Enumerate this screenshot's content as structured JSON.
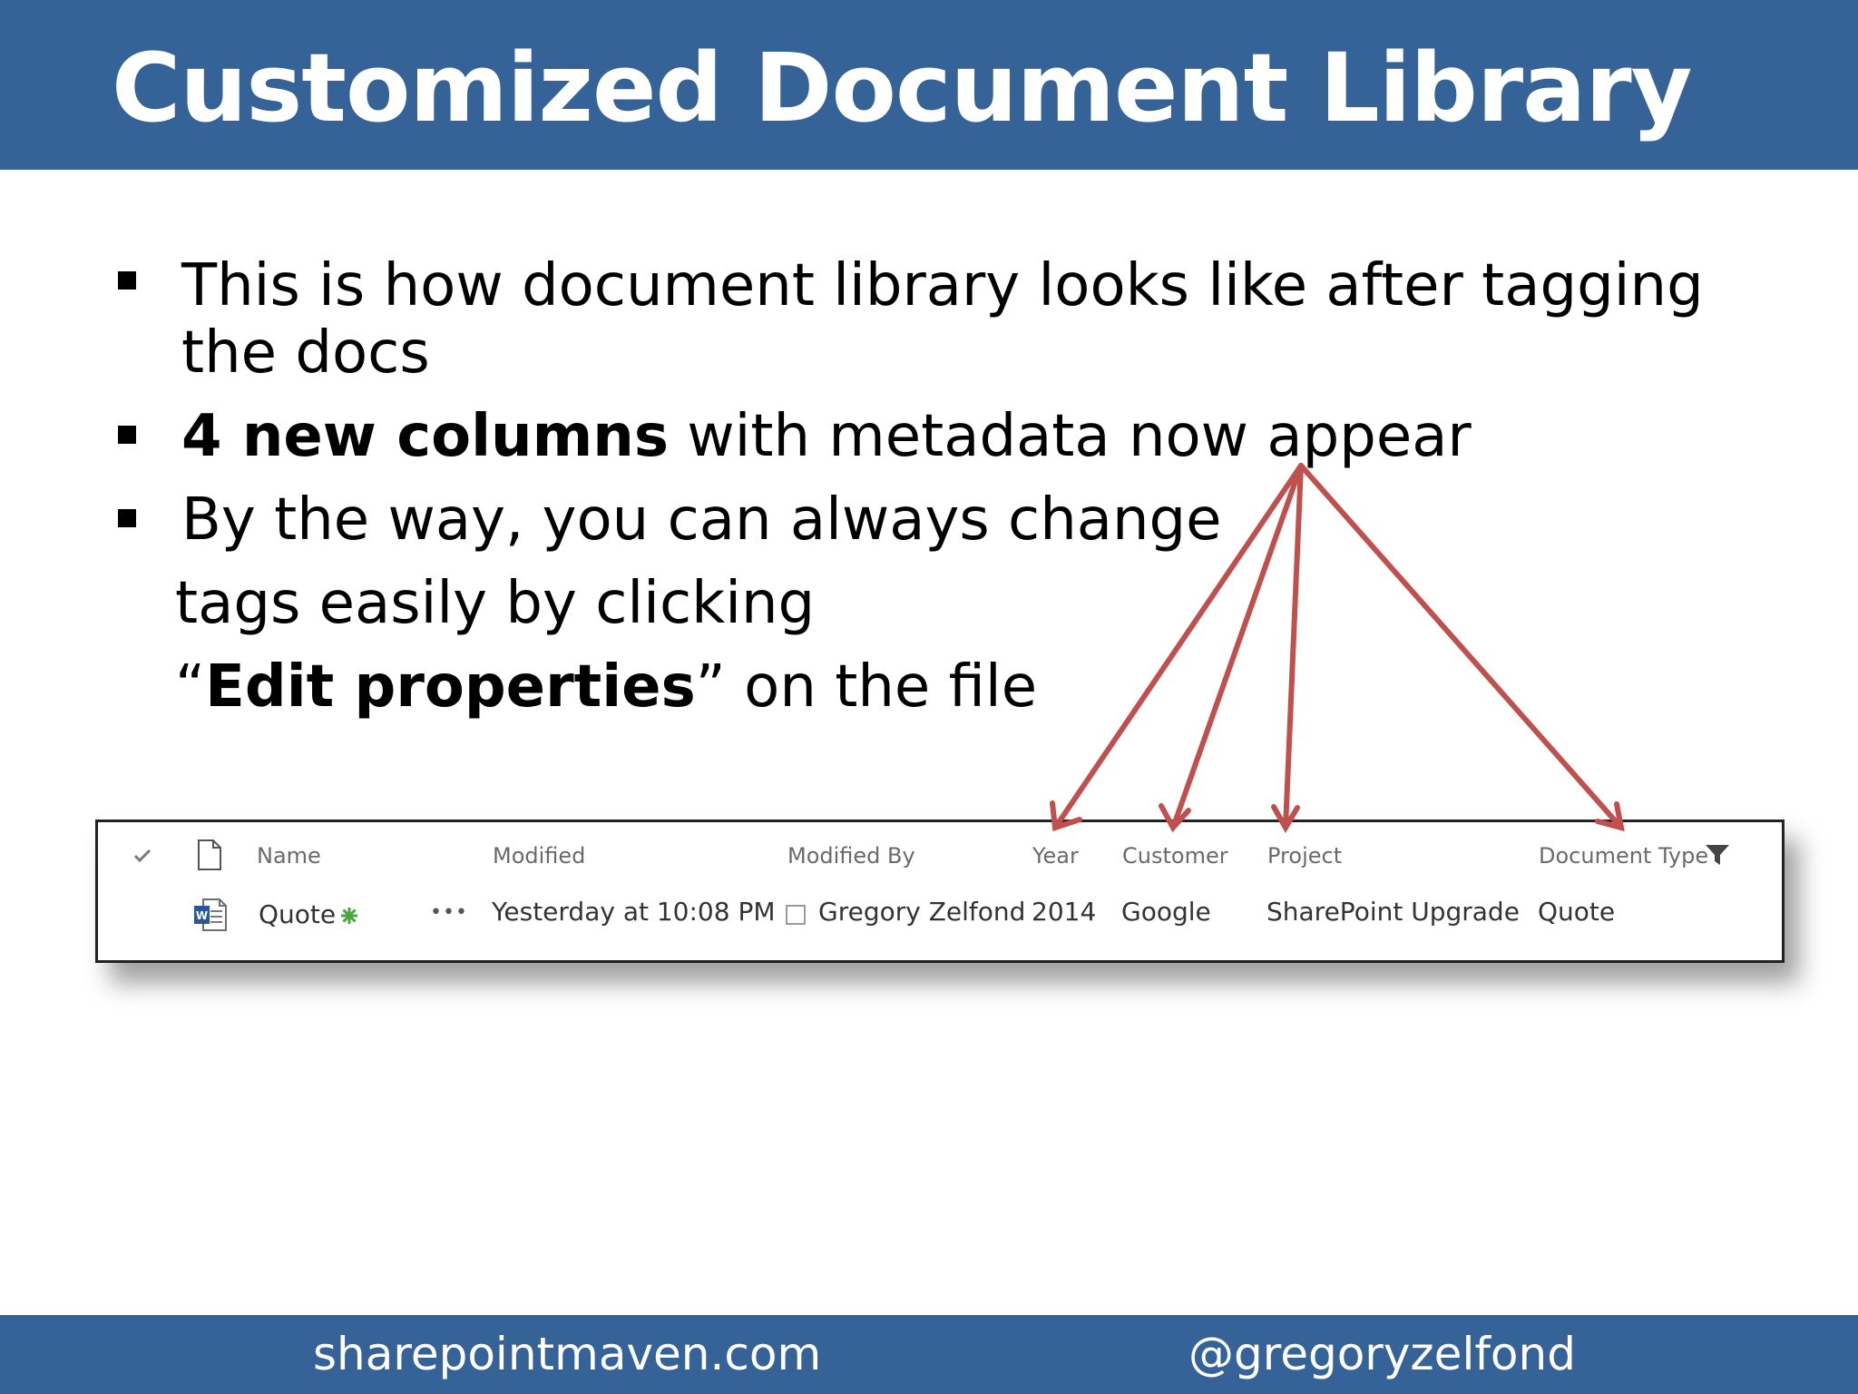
{
  "slide": {
    "title": "Customized Document Library",
    "bullets": [
      {
        "lines": [
          "This is how document library looks like after tagging",
          "the docs"
        ]
      },
      {
        "bold": "4 new columns",
        "rest": " with metadata now appear"
      },
      {
        "lines": [
          "By the way, you can always change",
          "tags easily by clicking"
        ],
        "quote_open": "“",
        "bold": "Edit properties",
        "quote_close": "”",
        "rest": " on the file"
      }
    ]
  },
  "library": {
    "columns": {
      "check_icon": "checkmark-icon",
      "type_icon": "document-icon",
      "name": "Name",
      "modified": "Modified",
      "modified_by": "Modified By",
      "year": "Year",
      "customer": "Customer",
      "project": "Project",
      "document_type": "Document Type",
      "filter_icon": "filter-icon"
    },
    "rows": [
      {
        "type_icon": "word-document-icon",
        "name": "Quote",
        "new_icon": "new-item-icon",
        "more": "•••",
        "modified": "Yesterday at 10:08 PM",
        "presence_icon": "presence-checkbox-icon",
        "modified_by": "Gregory Zelfond",
        "year": "2014",
        "customer": "Google",
        "project": "SharePoint Upgrade",
        "document_type": "Quote"
      }
    ]
  },
  "annotation": {
    "arrow_color": "#c0504d",
    "arrow_count": 4
  },
  "footer": {
    "left": "sharepointmaven.com",
    "right": "@gregoryzelfond"
  },
  "colors": {
    "brand_blue": "#356397",
    "text": "#000000",
    "header_gray": "#6a6a6a",
    "word_blue": "#2b579a",
    "new_green": "#4aa63a"
  }
}
